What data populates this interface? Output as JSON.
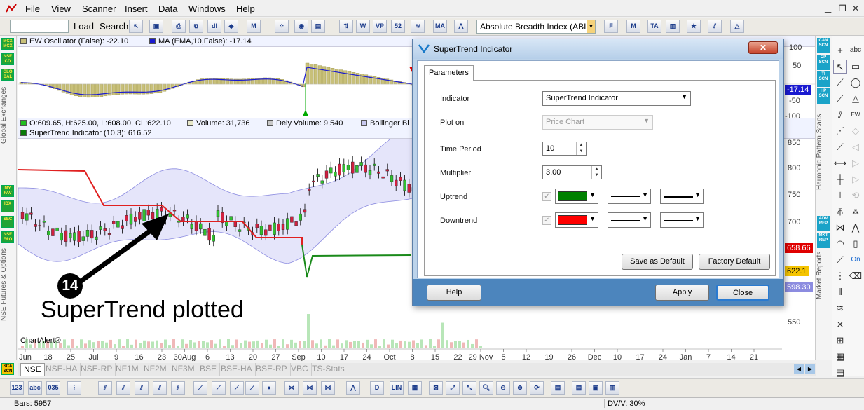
{
  "menu": {
    "items": [
      "File",
      "View",
      "Scanner",
      "Insert",
      "Data",
      "Windows",
      "Help"
    ]
  },
  "toolbar": {
    "load_label": "Load",
    "search_label": "Search",
    "symbol_value": "",
    "indicator_select_value": "Absolute Breadth Index (ABI"
  },
  "oscillator_legend": {
    "ew": "EW Oscillator (False): -22.10",
    "ma": "MA (EMA,10,False): -17.14"
  },
  "price_legend": {
    "ohlc": "O:609.65, H:625.00, L:608.00, CL:622.10",
    "volume": "Volume: 31,736",
    "dely_volume": "Dely Volume: 9,540",
    "bollinger": "Bollinger Bi",
    "supertrend": "SuperTrend Indicator (10,3): 616.52"
  },
  "left_rail": {
    "buttons": [
      "MCX MCX",
      "NSE CD",
      "GLO BAL",
      "MY FAV",
      "IDX",
      "SEC",
      "NSE F&O"
    ],
    "label_global": "Global Exchanges",
    "label_futures": "NSE Futures & Options",
    "bottom_btn": "SCA SCN"
  },
  "right_rail": {
    "buttons_top": [
      "CAN SCN",
      "CP SCN",
      "TI SCN",
      "HP SCN"
    ],
    "label_harmonic": "Harmonic Pattern Scans",
    "buttons_mid": [
      "ADV REP",
      "MKT REP"
    ],
    "label_market": "Market Reports"
  },
  "axis": {
    "osc_labels": [
      "100",
      "50",
      "-17.14",
      "-50",
      "-100"
    ],
    "price_labels": [
      "850",
      "800",
      "750",
      "700",
      "658.66",
      "622.1",
      "598.30",
      "550"
    ],
    "x_labels": [
      "Jun",
      "18",
      "25",
      "Jul",
      "9",
      "16",
      "23",
      "30Aug",
      "6",
      "13",
      "20",
      "27",
      "Sep",
      "10",
      "17",
      "24",
      "Oct",
      "8",
      "15",
      "22",
      "29 Nov",
      "5",
      "12",
      "19",
      "26",
      "Dec",
      "10",
      "17",
      "24",
      "Jan",
      "7",
      "14",
      "21"
    ]
  },
  "chart_credit": "ChartAlert®",
  "tabs": [
    "NSE",
    "NSE-HA",
    "NSE-RP",
    "NF1M",
    "NF2M",
    "NF3M",
    "BSE",
    "BSE-HA",
    "BSE-RP",
    "VBC",
    "TS-Stats"
  ],
  "status": {
    "bars": "Bars: 5957",
    "dvv": "DV/V: 30%"
  },
  "annotation": {
    "number": "14",
    "text": "SuperTrend plotted"
  },
  "dialog": {
    "title": "SuperTrend Indicator",
    "tab": "Parameters",
    "indicator_label": "Indicator",
    "indicator_value": "SuperTrend Indicator",
    "plot_on_label": "Plot on",
    "plot_on_value": "Price Chart",
    "time_period_label": "Time Period",
    "time_period_value": "10",
    "multiplier_label": "Multiplier",
    "multiplier_value": "3.00",
    "uptrend_label": "Uptrend",
    "uptrend_color": "#008000",
    "downtrend_label": "Downtrend",
    "downtrend_color": "#ff0000",
    "save_default": "Save as Default",
    "factory_default": "Factory Default",
    "help": "Help",
    "apply": "Apply",
    "close": "Close"
  },
  "colors": {
    "supertrend_down": "#e02020",
    "supertrend_up": "#1a8a1a",
    "bollinger_fill": "#dcdcf8",
    "osc_bars": "#c8c07a",
    "ma_line": "#1a1ad0"
  }
}
